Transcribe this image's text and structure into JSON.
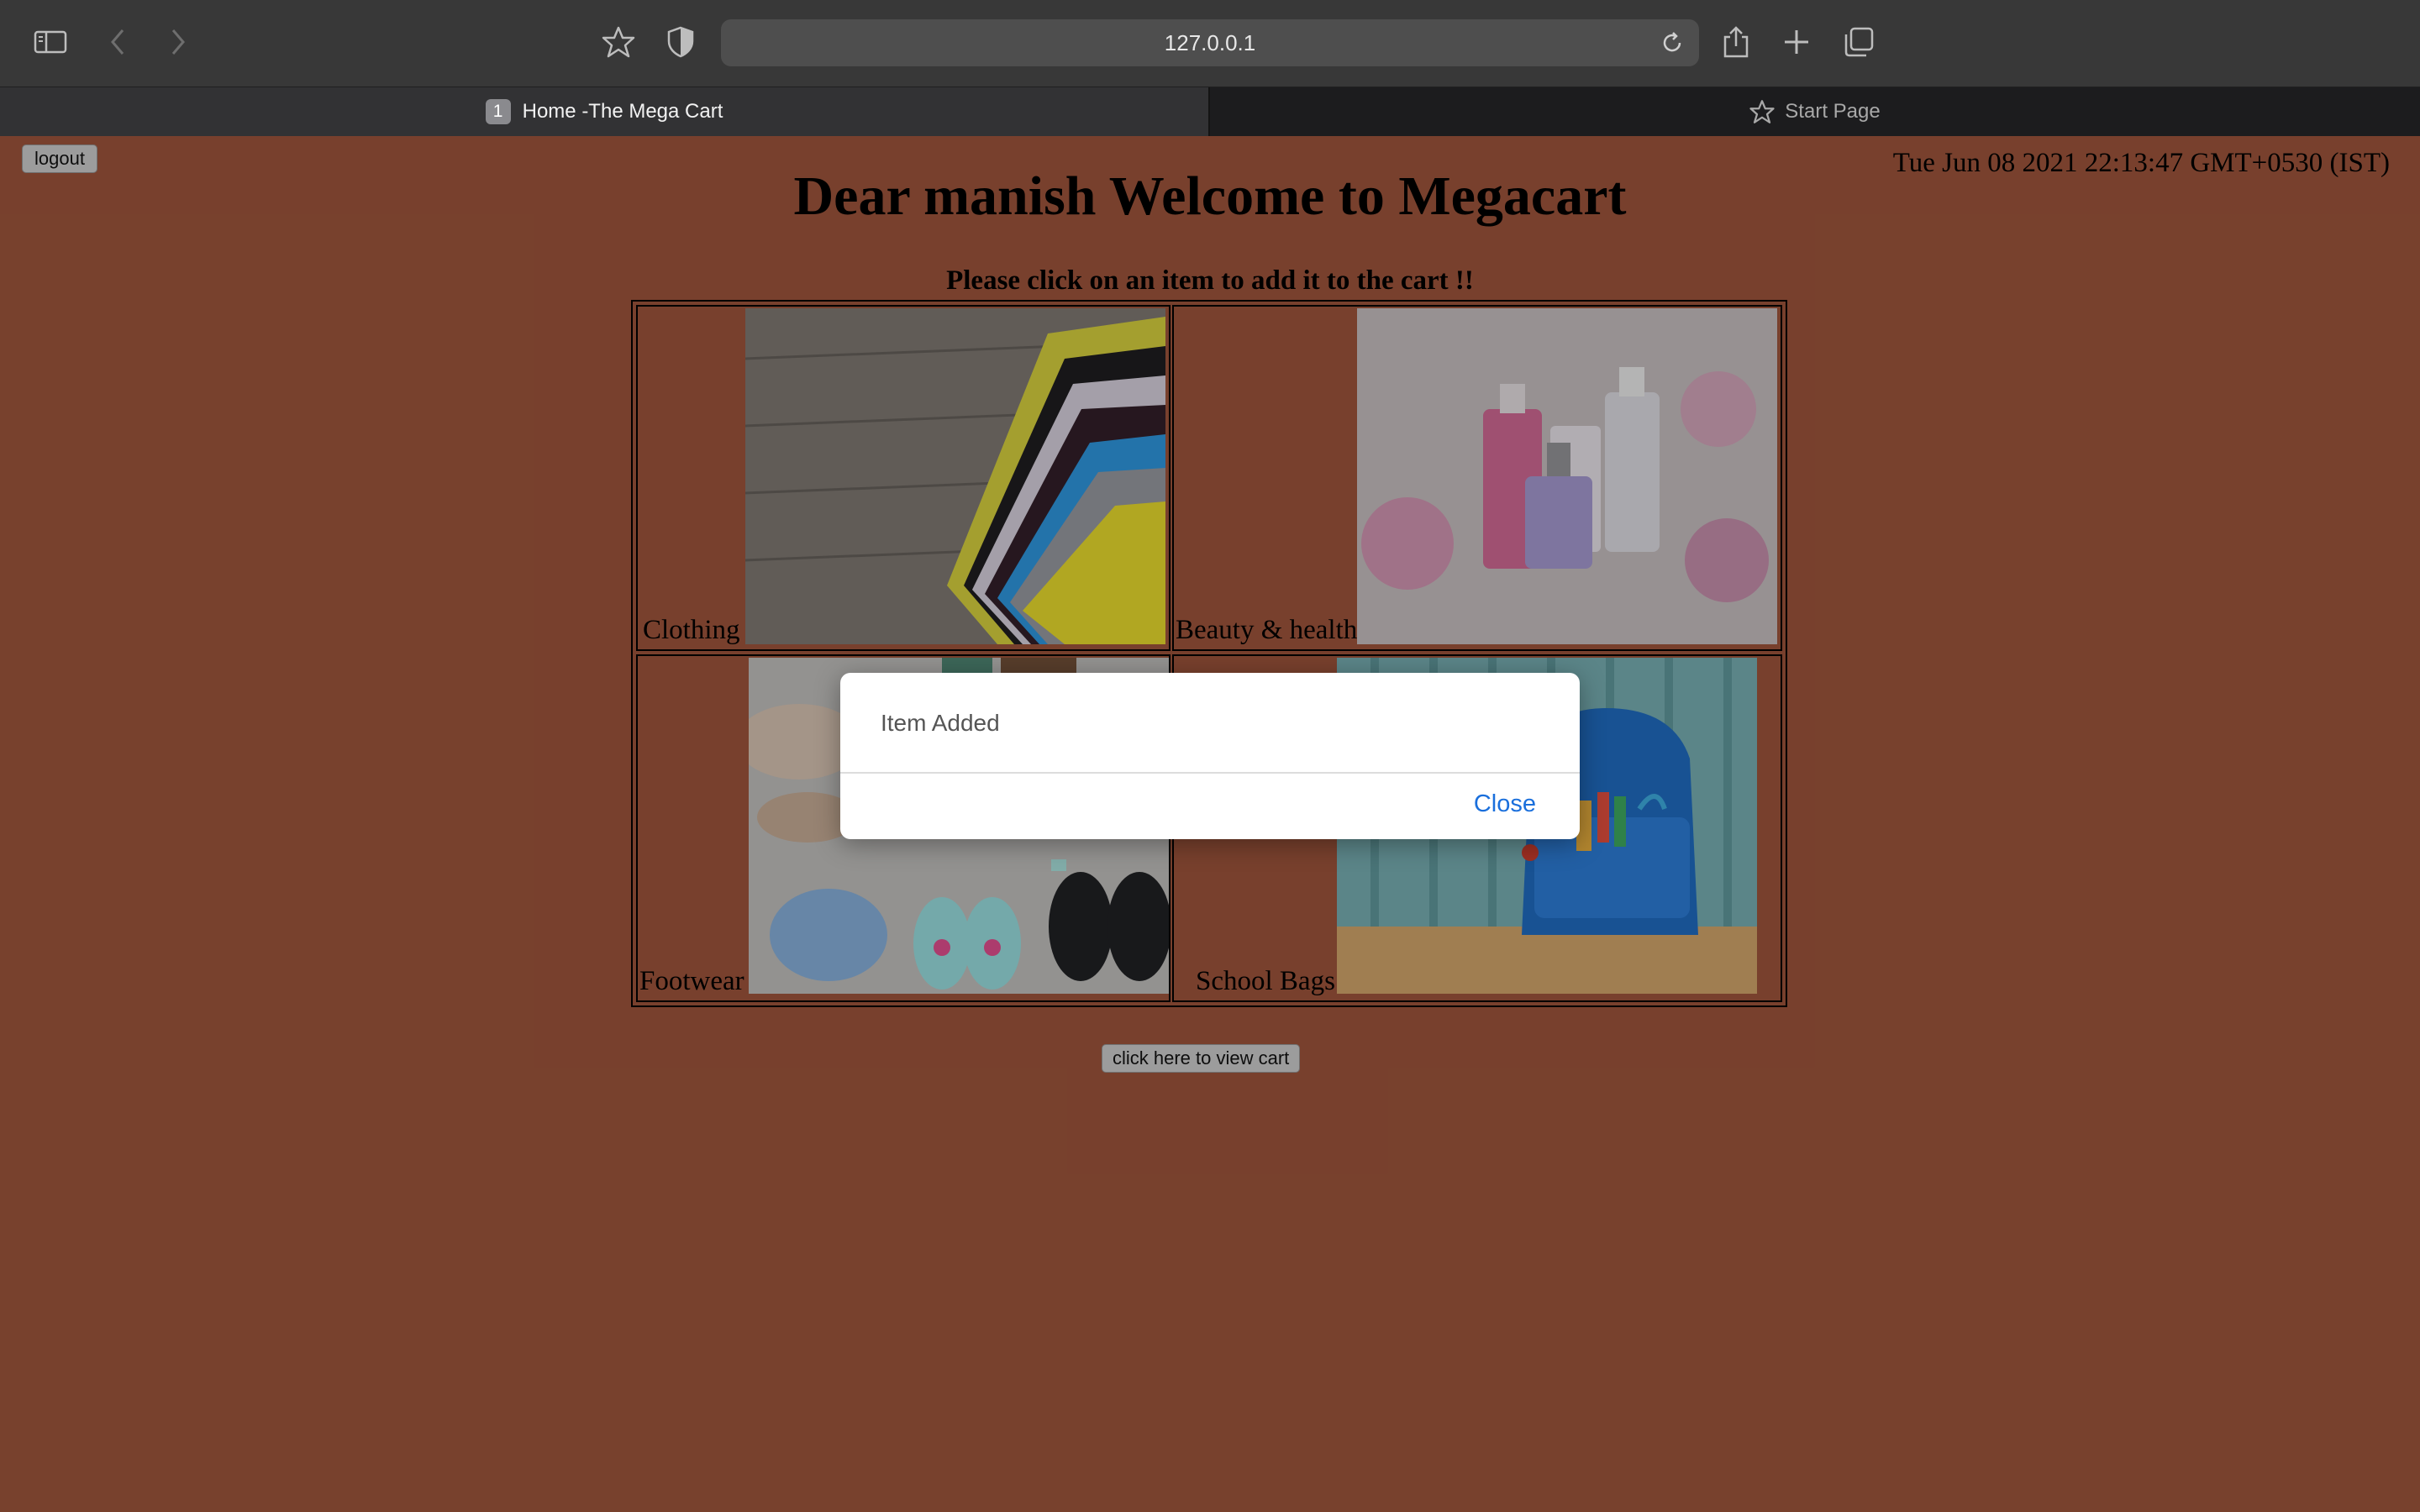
{
  "browser": {
    "address": "127.0.0.1",
    "tabs": [
      {
        "number": "1",
        "label": "Home -The Mega Cart",
        "active": true
      },
      {
        "label": "Start Page",
        "active": false,
        "icon": "star-icon"
      }
    ],
    "icons": [
      "sidebar-icon",
      "back-icon",
      "forward-icon",
      "bookmark-star-icon",
      "privacy-shield-icon",
      "reload-icon",
      "share-icon",
      "new-tab-icon",
      "tab-overview-icon"
    ]
  },
  "page": {
    "logout_label": "logout",
    "datetime": "Tue Jun 08 2021 22:13:47 GMT+0530 (IST)",
    "heading": "Dear manish Welcome to Megacart",
    "instruction": "Please click on an item to add it to the cart !!",
    "categories": [
      {
        "label": "Clothing"
      },
      {
        "label": "Beauty & health"
      },
      {
        "label": "Footwear"
      },
      {
        "label": "School Bags"
      }
    ],
    "view_cart_label": "click here to view cart"
  },
  "modal": {
    "message": "Item Added",
    "close_label": "Close"
  },
  "colors": {
    "page_background": "#934f37",
    "link_blue": "#1a6fdc"
  }
}
